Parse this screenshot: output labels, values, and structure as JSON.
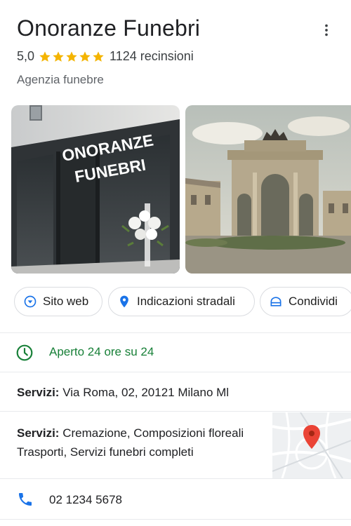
{
  "place": {
    "name": "Onoranze Funebri",
    "rating": "5,0",
    "stars": 5,
    "reviews": "1124 recinsioni",
    "category": "Agenzia funebre"
  },
  "photos": {
    "storefront_sign_line1": "ONORANZE",
    "storefront_sign_line2": "FUNEBRI"
  },
  "actions": {
    "website": "Sito web",
    "directions": "Indicazioni stradali",
    "share": "Condividi"
  },
  "hours": {
    "status": "Aperto 24 ore su 24"
  },
  "address": {
    "label": "Servizi:",
    "value": " Via Roma, 02, 20121 Milano Ml"
  },
  "services": {
    "label": "Servizi:",
    "line1": " Cremazione, Composizioni floreali",
    "line2": "Trasporti, Servizi funebri completi"
  },
  "phone": {
    "number": "02 1234 5678"
  },
  "colors": {
    "accent_blue": "#1a73e8",
    "open_green": "#188038",
    "star_gold": "#f4b400",
    "pin_red": "#ea4335"
  }
}
